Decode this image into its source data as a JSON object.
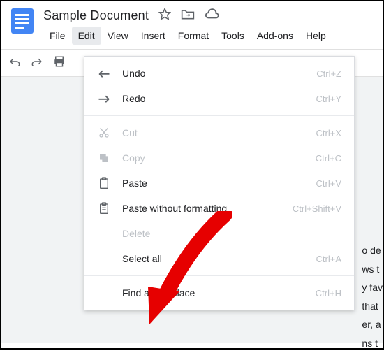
{
  "document": {
    "title": "Sample Document"
  },
  "menubar": {
    "items": [
      "File",
      "Edit",
      "View",
      "Insert",
      "Format",
      "Tools",
      "Add-ons",
      "Help"
    ],
    "activeIndex": 1
  },
  "editMenu": {
    "undo": {
      "label": "Undo",
      "shortcut": "Ctrl+Z"
    },
    "redo": {
      "label": "Redo",
      "shortcut": "Ctrl+Y"
    },
    "cut": {
      "label": "Cut",
      "shortcut": "Ctrl+X"
    },
    "copy": {
      "label": "Copy",
      "shortcut": "Ctrl+C"
    },
    "paste": {
      "label": "Paste",
      "shortcut": "Ctrl+V"
    },
    "pasteNoFmt": {
      "label": "Paste without formatting",
      "shortcut": "Ctrl+Shift+V"
    },
    "delete": {
      "label": "Delete"
    },
    "selectAll": {
      "label": "Select all",
      "shortcut": "Ctrl+A"
    },
    "findReplace": {
      "label": "Find and replace",
      "shortcut": "Ctrl+H"
    }
  },
  "pageFragments": [
    "o de",
    "ws t",
    "",
    "y fav",
    " that",
    "er, a",
    "",
    "ns t"
  ]
}
